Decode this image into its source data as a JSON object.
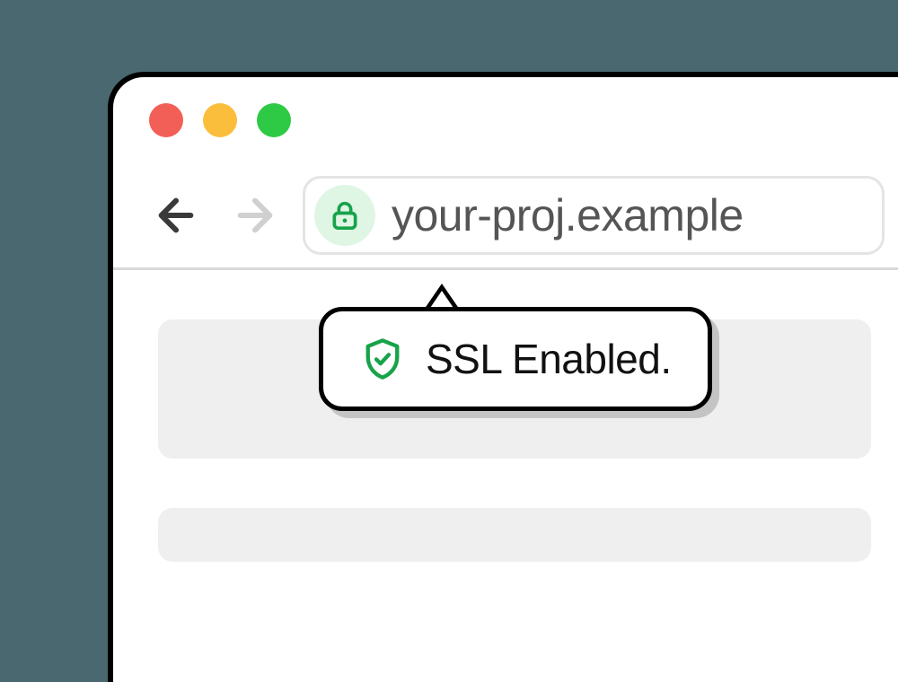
{
  "browser": {
    "traffic_lights": {
      "close_color": "#F25F57",
      "minimize_color": "#FBBE3C",
      "maximize_color": "#2ECA45"
    },
    "address_bar": {
      "url": "your-proj.example"
    }
  },
  "popover": {
    "message": "SSL Enabled."
  },
  "colors": {
    "accent_green": "#17A34A",
    "lock_bg": "#DFF6E5",
    "page_bg": "#4A6870"
  }
}
